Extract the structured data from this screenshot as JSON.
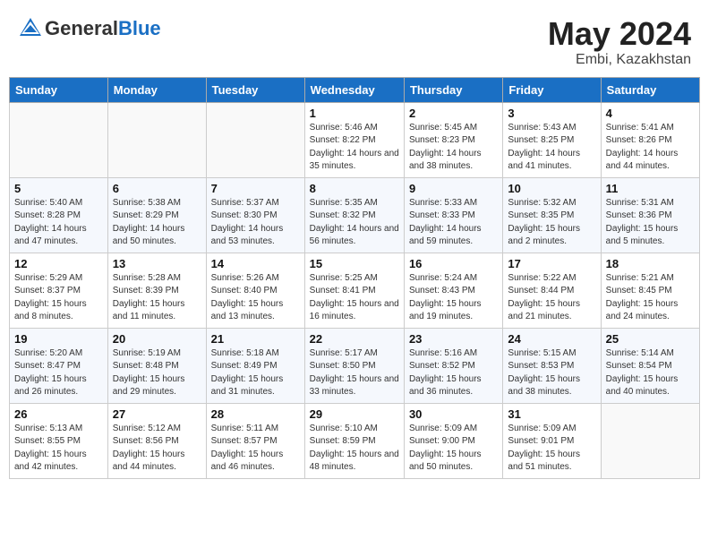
{
  "header": {
    "logo_general": "General",
    "logo_blue": "Blue",
    "month": "May 2024",
    "location": "Embi, Kazakhstan"
  },
  "weekdays": [
    "Sunday",
    "Monday",
    "Tuesday",
    "Wednesday",
    "Thursday",
    "Friday",
    "Saturday"
  ],
  "weeks": [
    [
      {
        "day": "",
        "sunrise": "",
        "sunset": "",
        "daylight": ""
      },
      {
        "day": "",
        "sunrise": "",
        "sunset": "",
        "daylight": ""
      },
      {
        "day": "",
        "sunrise": "",
        "sunset": "",
        "daylight": ""
      },
      {
        "day": "1",
        "sunrise": "Sunrise: 5:46 AM",
        "sunset": "Sunset: 8:22 PM",
        "daylight": "Daylight: 14 hours and 35 minutes."
      },
      {
        "day": "2",
        "sunrise": "Sunrise: 5:45 AM",
        "sunset": "Sunset: 8:23 PM",
        "daylight": "Daylight: 14 hours and 38 minutes."
      },
      {
        "day": "3",
        "sunrise": "Sunrise: 5:43 AM",
        "sunset": "Sunset: 8:25 PM",
        "daylight": "Daylight: 14 hours and 41 minutes."
      },
      {
        "day": "4",
        "sunrise": "Sunrise: 5:41 AM",
        "sunset": "Sunset: 8:26 PM",
        "daylight": "Daylight: 14 hours and 44 minutes."
      }
    ],
    [
      {
        "day": "5",
        "sunrise": "Sunrise: 5:40 AM",
        "sunset": "Sunset: 8:28 PM",
        "daylight": "Daylight: 14 hours and 47 minutes."
      },
      {
        "day": "6",
        "sunrise": "Sunrise: 5:38 AM",
        "sunset": "Sunset: 8:29 PM",
        "daylight": "Daylight: 14 hours and 50 minutes."
      },
      {
        "day": "7",
        "sunrise": "Sunrise: 5:37 AM",
        "sunset": "Sunset: 8:30 PM",
        "daylight": "Daylight: 14 hours and 53 minutes."
      },
      {
        "day": "8",
        "sunrise": "Sunrise: 5:35 AM",
        "sunset": "Sunset: 8:32 PM",
        "daylight": "Daylight: 14 hours and 56 minutes."
      },
      {
        "day": "9",
        "sunrise": "Sunrise: 5:33 AM",
        "sunset": "Sunset: 8:33 PM",
        "daylight": "Daylight: 14 hours and 59 minutes."
      },
      {
        "day": "10",
        "sunrise": "Sunrise: 5:32 AM",
        "sunset": "Sunset: 8:35 PM",
        "daylight": "Daylight: 15 hours and 2 minutes."
      },
      {
        "day": "11",
        "sunrise": "Sunrise: 5:31 AM",
        "sunset": "Sunset: 8:36 PM",
        "daylight": "Daylight: 15 hours and 5 minutes."
      }
    ],
    [
      {
        "day": "12",
        "sunrise": "Sunrise: 5:29 AM",
        "sunset": "Sunset: 8:37 PM",
        "daylight": "Daylight: 15 hours and 8 minutes."
      },
      {
        "day": "13",
        "sunrise": "Sunrise: 5:28 AM",
        "sunset": "Sunset: 8:39 PM",
        "daylight": "Daylight: 15 hours and 11 minutes."
      },
      {
        "day": "14",
        "sunrise": "Sunrise: 5:26 AM",
        "sunset": "Sunset: 8:40 PM",
        "daylight": "Daylight: 15 hours and 13 minutes."
      },
      {
        "day": "15",
        "sunrise": "Sunrise: 5:25 AM",
        "sunset": "Sunset: 8:41 PM",
        "daylight": "Daylight: 15 hours and 16 minutes."
      },
      {
        "day": "16",
        "sunrise": "Sunrise: 5:24 AM",
        "sunset": "Sunset: 8:43 PM",
        "daylight": "Daylight: 15 hours and 19 minutes."
      },
      {
        "day": "17",
        "sunrise": "Sunrise: 5:22 AM",
        "sunset": "Sunset: 8:44 PM",
        "daylight": "Daylight: 15 hours and 21 minutes."
      },
      {
        "day": "18",
        "sunrise": "Sunrise: 5:21 AM",
        "sunset": "Sunset: 8:45 PM",
        "daylight": "Daylight: 15 hours and 24 minutes."
      }
    ],
    [
      {
        "day": "19",
        "sunrise": "Sunrise: 5:20 AM",
        "sunset": "Sunset: 8:47 PM",
        "daylight": "Daylight: 15 hours and 26 minutes."
      },
      {
        "day": "20",
        "sunrise": "Sunrise: 5:19 AM",
        "sunset": "Sunset: 8:48 PM",
        "daylight": "Daylight: 15 hours and 29 minutes."
      },
      {
        "day": "21",
        "sunrise": "Sunrise: 5:18 AM",
        "sunset": "Sunset: 8:49 PM",
        "daylight": "Daylight: 15 hours and 31 minutes."
      },
      {
        "day": "22",
        "sunrise": "Sunrise: 5:17 AM",
        "sunset": "Sunset: 8:50 PM",
        "daylight": "Daylight: 15 hours and 33 minutes."
      },
      {
        "day": "23",
        "sunrise": "Sunrise: 5:16 AM",
        "sunset": "Sunset: 8:52 PM",
        "daylight": "Daylight: 15 hours and 36 minutes."
      },
      {
        "day": "24",
        "sunrise": "Sunrise: 5:15 AM",
        "sunset": "Sunset: 8:53 PM",
        "daylight": "Daylight: 15 hours and 38 minutes."
      },
      {
        "day": "25",
        "sunrise": "Sunrise: 5:14 AM",
        "sunset": "Sunset: 8:54 PM",
        "daylight": "Daylight: 15 hours and 40 minutes."
      }
    ],
    [
      {
        "day": "26",
        "sunrise": "Sunrise: 5:13 AM",
        "sunset": "Sunset: 8:55 PM",
        "daylight": "Daylight: 15 hours and 42 minutes."
      },
      {
        "day": "27",
        "sunrise": "Sunrise: 5:12 AM",
        "sunset": "Sunset: 8:56 PM",
        "daylight": "Daylight: 15 hours and 44 minutes."
      },
      {
        "day": "28",
        "sunrise": "Sunrise: 5:11 AM",
        "sunset": "Sunset: 8:57 PM",
        "daylight": "Daylight: 15 hours and 46 minutes."
      },
      {
        "day": "29",
        "sunrise": "Sunrise: 5:10 AM",
        "sunset": "Sunset: 8:59 PM",
        "daylight": "Daylight: 15 hours and 48 minutes."
      },
      {
        "day": "30",
        "sunrise": "Sunrise: 5:09 AM",
        "sunset": "Sunset: 9:00 PM",
        "daylight": "Daylight: 15 hours and 50 minutes."
      },
      {
        "day": "31",
        "sunrise": "Sunrise: 5:09 AM",
        "sunset": "Sunset: 9:01 PM",
        "daylight": "Daylight: 15 hours and 51 minutes."
      },
      {
        "day": "",
        "sunrise": "",
        "sunset": "",
        "daylight": ""
      }
    ]
  ]
}
